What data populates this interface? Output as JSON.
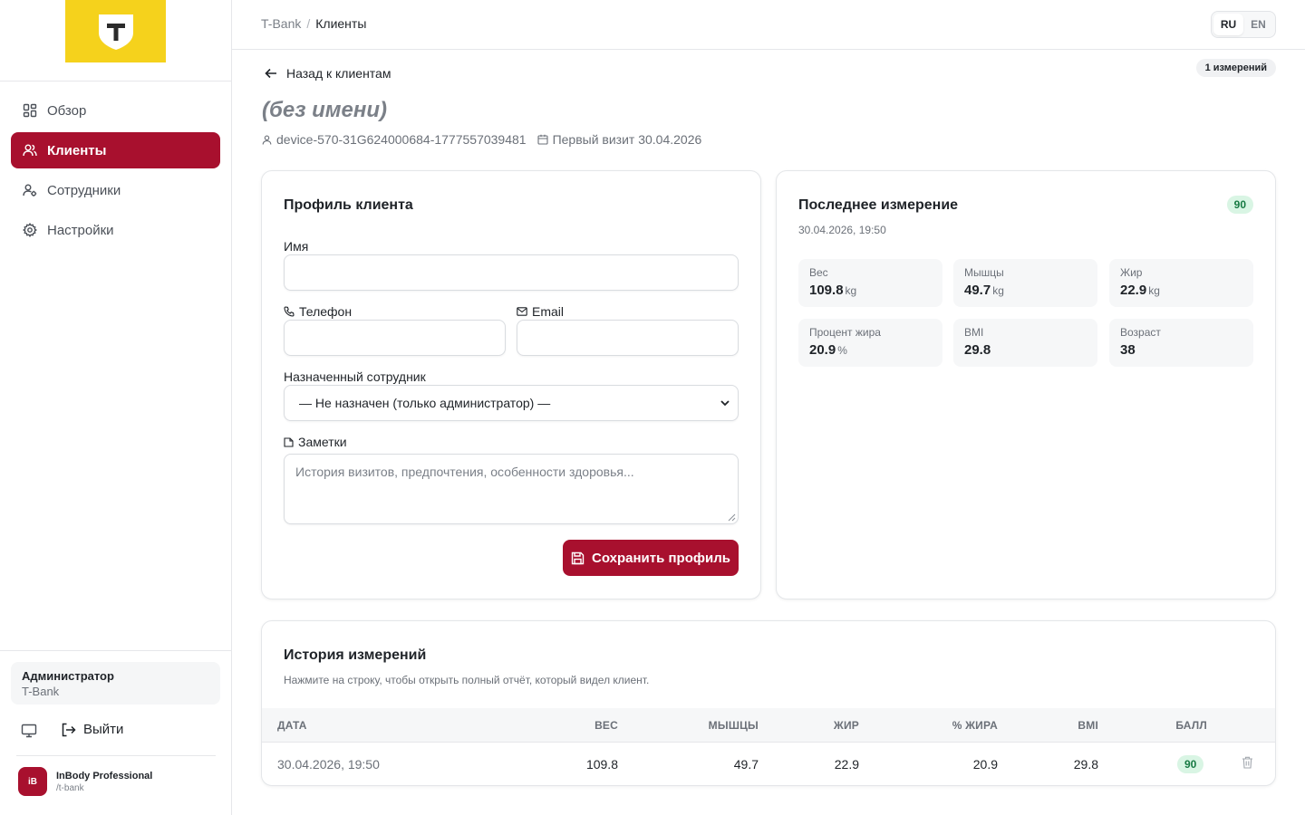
{
  "header": {
    "breadcrumb_root": "T-Bank",
    "breadcrumb_sep": "/",
    "breadcrumb_current": "Клиенты",
    "lang_ru": "RU",
    "lang_en": "EN"
  },
  "sidebar": {
    "items": [
      {
        "label": "Обзор",
        "icon": "dashboard-icon",
        "active": false
      },
      {
        "label": "Клиенты",
        "icon": "users-icon",
        "active": true
      },
      {
        "label": "Сотрудники",
        "icon": "staff-icon",
        "active": false
      },
      {
        "label": "Настройки",
        "icon": "gear-icon",
        "active": false
      }
    ],
    "user_role": "Администратор",
    "user_org": "T-Bank",
    "logout_label": "Выйти",
    "brand_badge": "iB",
    "brand_name": "InBody Professional",
    "brand_slug": "/t-bank"
  },
  "client": {
    "back_label": "Назад к клиентам",
    "measurements_count": "1 измерений",
    "name": "(без имени)",
    "device_id": "device-570-31G624000684-1777557039481",
    "first_visit": "Первый визит 30.04.2026"
  },
  "profile": {
    "title": "Профиль клиента",
    "name_label": "Имя",
    "phone_label": "Телефон",
    "email_label": "Email",
    "staff_label": "Назначенный сотрудник",
    "staff_selected": "— Не назначен (только администратор) —",
    "notes_label": "Заметки",
    "notes_placeholder": "История визитов, предпочтения, особенности здоровья...",
    "save_label": "Сохранить профиль"
  },
  "last_measurement": {
    "title": "Последнее измерение",
    "date": "30.04.2026, 19:50",
    "score": "90",
    "stats": [
      {
        "label": "Вес",
        "value": "109.8",
        "unit": "kg"
      },
      {
        "label": "Мышцы",
        "value": "49.7",
        "unit": "kg"
      },
      {
        "label": "Жир",
        "value": "22.9",
        "unit": "kg"
      },
      {
        "label": "Процент жира",
        "value": "20.9",
        "unit": "%"
      },
      {
        "label": "BMI",
        "value": "29.8",
        "unit": ""
      },
      {
        "label": "Возраст",
        "value": "38",
        "unit": ""
      }
    ]
  },
  "history": {
    "title": "История измерений",
    "hint": "Нажмите на строку, чтобы открыть полный отчёт, который видел клиент.",
    "columns": [
      "ДАТА",
      "ВЕС",
      "МЫШЦЫ",
      "ЖИР",
      "% ЖИРА",
      "BMI",
      "БАЛЛ"
    ],
    "rows": [
      {
        "date": "30.04.2026, 19:50",
        "weight": "109.8",
        "muscle": "49.7",
        "fat": "22.9",
        "fat_pct": "20.9",
        "bmi": "29.8",
        "score": "90"
      }
    ]
  },
  "colors": {
    "accent": "#a8102e",
    "logo_yellow": "#f5d21c",
    "score_bg": "#d9f5e4",
    "score_text": "#177a43"
  }
}
